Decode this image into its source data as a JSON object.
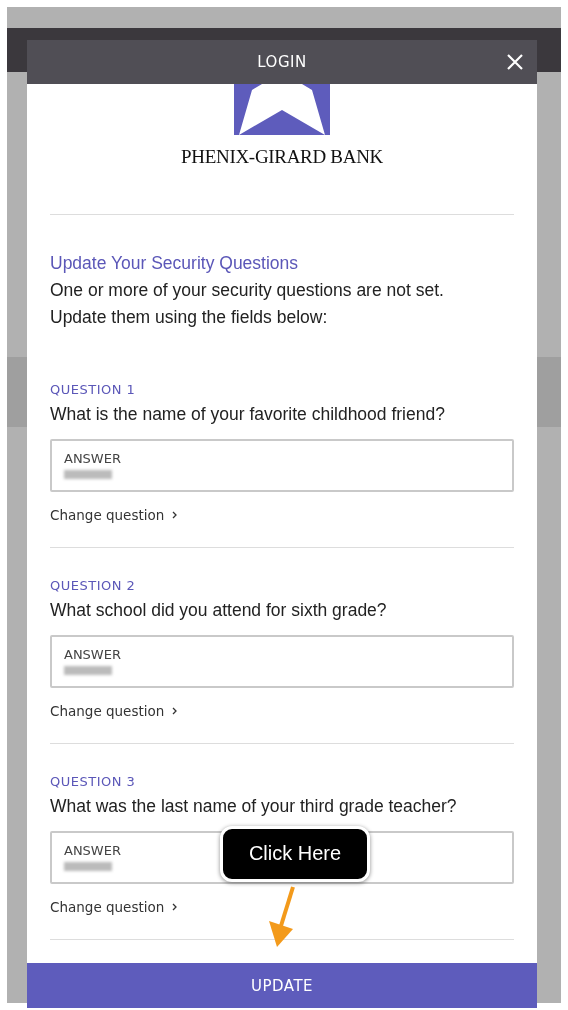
{
  "header": {
    "title": "LOGIN"
  },
  "logo": {
    "bank_name": "PHENIX-GIRARD BANK"
  },
  "heading": "Update Your Security Questions",
  "intro": [
    "One or more of your security questions are not set.",
    "Update them using the fields below:"
  ],
  "questions": [
    {
      "label": "QUESTION 1",
      "question": "What is the name of your favorite childhood friend?",
      "field_label": "ANSWER",
      "change_link": "Change question"
    },
    {
      "label": "QUESTION 2",
      "question": "What school did you attend for sixth grade?",
      "field_label": "ANSWER",
      "change_link": "Change question"
    },
    {
      "label": "QUESTION 3",
      "question": "What was the last name of your third grade teacher?",
      "field_label": "ANSWER",
      "change_link": "Change question"
    }
  ],
  "update_button": "UPDATE",
  "callout": {
    "text": "Click Here"
  }
}
